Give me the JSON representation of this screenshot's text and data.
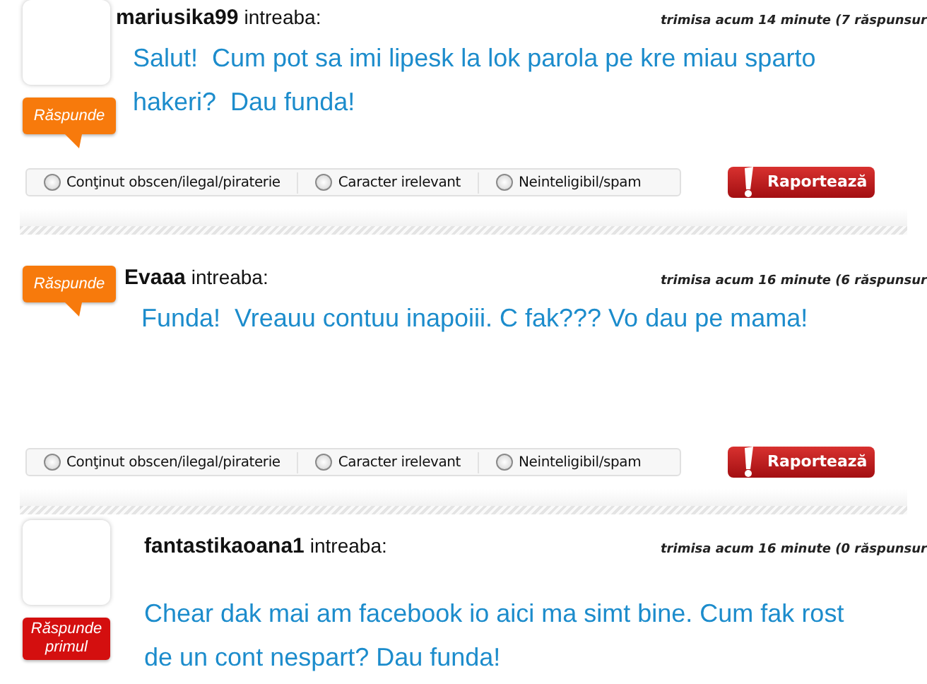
{
  "posts": [
    {
      "avatar": true,
      "answer_button": {
        "kind": "answer",
        "label": "Răspunde"
      },
      "username": "mariusika99",
      "asks": "intreaba:",
      "time": "trimisa acum 14 minute (7 răspunsur",
      "message": "Salut!  Cum pot sa imi lipesk la lok parola pe kre miau sparto hakeri?  Dau funda!",
      "report_options": [
        {
          "label": "Conţinut obscen/ilegal/piraterie",
          "selected": false
        },
        {
          "label": "Caracter irelevant",
          "selected": false
        },
        {
          "label": "Neinteligibil/spam",
          "selected": false
        }
      ],
      "report_button": "Raportează"
    },
    {
      "avatar": false,
      "answer_button": {
        "kind": "answer",
        "label": "Răspunde"
      },
      "username": "Evaaa",
      "asks": "intreaba:",
      "time": "trimisa acum 16 minute (6 răspunsur",
      "message": "Funda!  Vreauu contuu inapoiii. C fak??? Vo dau pe mama!",
      "report_options": [
        {
          "label": "Conţinut obscen/ilegal/piraterie",
          "selected": false
        },
        {
          "label": "Caracter irelevant",
          "selected": false
        },
        {
          "label": "Neinteligibil/spam",
          "selected": false
        }
      ],
      "report_button": "Raportează"
    },
    {
      "avatar": true,
      "answer_button": {
        "kind": "answer_first",
        "label": "Răspunde primul"
      },
      "username": "fantastikaoana1",
      "asks": "intreaba:",
      "time": "trimisa acum 16 minute (0 răspunsur",
      "message": "Chear dak mai am facebook io aici ma simt bine. Cum fak rost de un cont nespart? Dau funda!"
    }
  ]
}
